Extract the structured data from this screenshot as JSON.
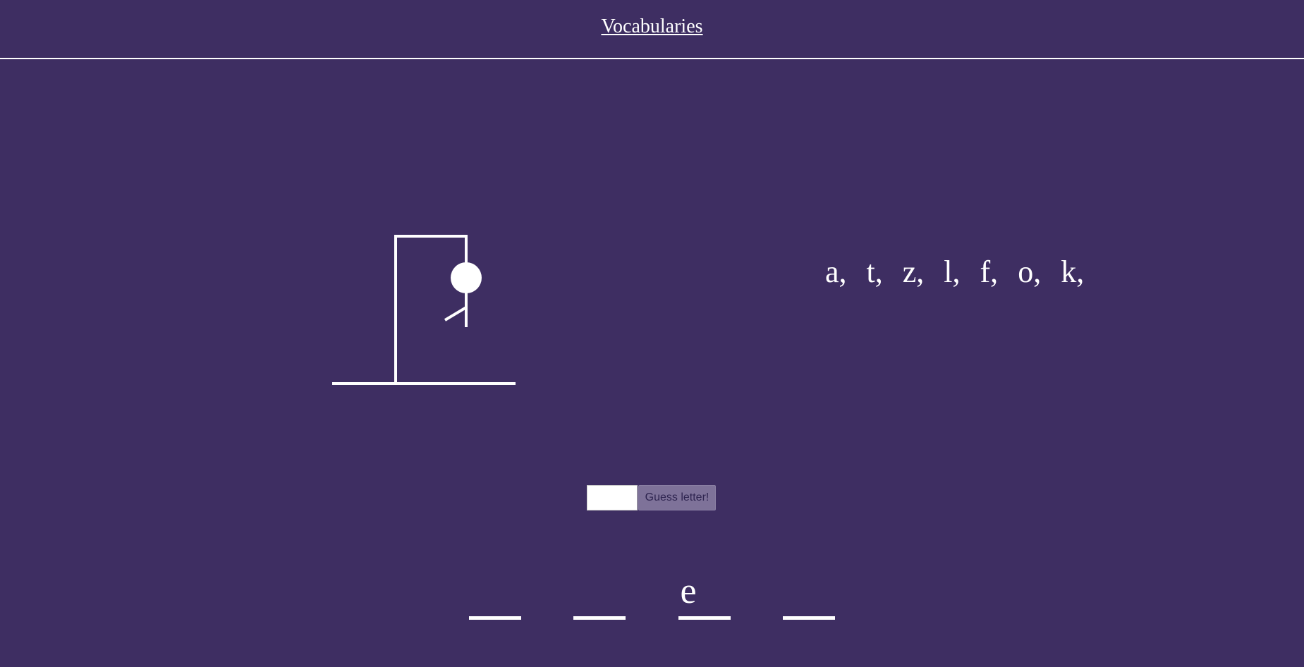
{
  "header": {
    "title": "Vocabularies"
  },
  "hangman": {
    "wrong_guesses": 7
  },
  "guessed_letters": [
    "a,",
    "t,",
    "z,",
    "l,",
    "f,",
    "o,",
    "k,"
  ],
  "guess_form": {
    "input_value": "",
    "button_label": "Guess letter!"
  },
  "word_slots": [
    {
      "letter": ""
    },
    {
      "letter": ""
    },
    {
      "letter": "e"
    },
    {
      "letter": ""
    }
  ],
  "colors": {
    "background": "#3e2e62",
    "foreground": "#ffffff",
    "button": "#7e7299"
  }
}
